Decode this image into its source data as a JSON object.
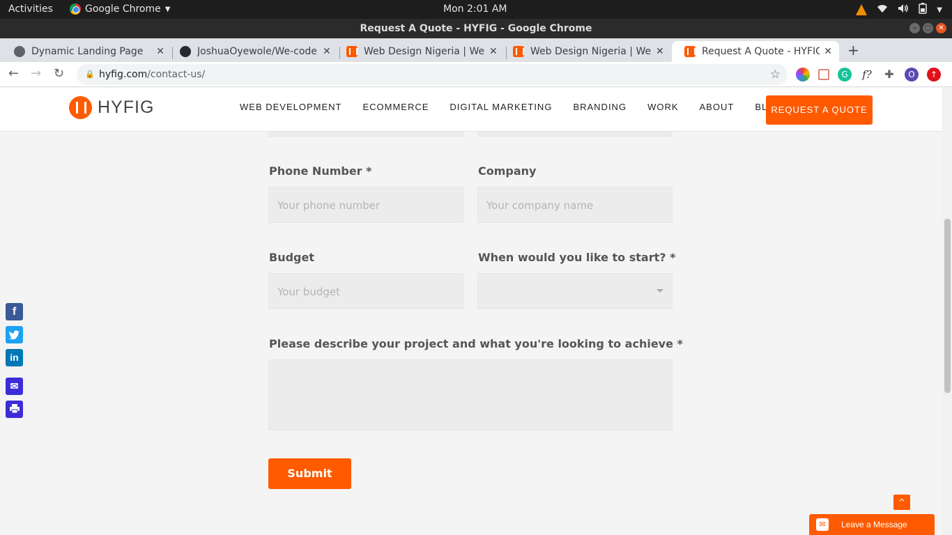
{
  "system": {
    "activities": "Activities",
    "app_name": "Google Chrome",
    "clock": "Mon  2:01 AM"
  },
  "window": {
    "title": "Request A Quote - HYFIG - Google Chrome"
  },
  "tabs": [
    {
      "title": "Dynamic Landing Page",
      "favicon": "globe-icon"
    },
    {
      "title": "JoshuaOyewole/We-code",
      "favicon": "github-icon"
    },
    {
      "title": "Web Design Nigeria | Web",
      "favicon": "hyfig-icon"
    },
    {
      "title": "Web Design Nigeria | Web",
      "favicon": "hyfig-icon"
    },
    {
      "title": "Request A Quote - HYFIG",
      "favicon": "hyfig-icon",
      "active": true
    }
  ],
  "address_bar": {
    "domain": "hyfig.com",
    "path": "/contact-us/"
  },
  "extensions": {
    "profile_initial": "O",
    "formula": "f?"
  },
  "site": {
    "brand": "HYFIG",
    "nav": [
      "WEB DEVELOPMENT",
      "ECOMMERCE",
      "DIGITAL MARKETING",
      "BRANDING",
      "WORK",
      "ABOUT",
      "BLOG"
    ],
    "cta": "REQUEST A QUOTE",
    "accent_color": "#ff5a00"
  },
  "form": {
    "phone": {
      "label": "Phone Number *",
      "placeholder": "Your phone number"
    },
    "company": {
      "label": "Company",
      "placeholder": "Your company name"
    },
    "budget": {
      "label": "Budget",
      "placeholder": "Your budget"
    },
    "start": {
      "label": "When would you like to start? *",
      "value": ""
    },
    "description": {
      "label": "Please describe your project and what you're looking to achieve *",
      "value": ""
    },
    "submit": "Submit"
  },
  "share_buttons": [
    "facebook-icon",
    "twitter-icon",
    "linkedin-icon",
    "email-icon",
    "print-icon"
  ],
  "chat": {
    "label": "Leave a Message"
  }
}
